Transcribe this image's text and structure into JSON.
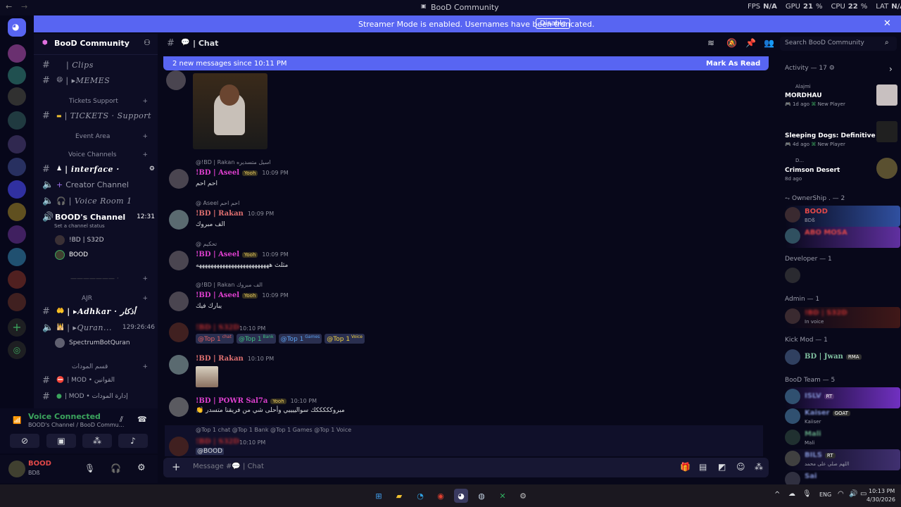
{
  "titlebar": {
    "title": "BooD Community",
    "fps_label": "FPS",
    "fps_value": "N/A",
    "gpu_label": "GPU",
    "gpu_value": "21",
    "cpu_label": "CPU",
    "cpu_value": "22",
    "lat_label": "LAT",
    "lat_value": "N/A"
  },
  "banner": {
    "text": "Streamer Mode is enabled. Usernames have been truncated.",
    "button": "Disable"
  },
  "server": {
    "name": "BooD Community"
  },
  "channels": {
    "clips": "| Clips",
    "memes": "| ▸MEMES",
    "cat_tickets": "Tickets Support",
    "tickets": "| TICKETS · Support",
    "cat_event": "Event Area",
    "cat_voice": "Voice Channels",
    "interface": "| interface ·",
    "creator": "Creator Channel",
    "voice_room": "| Voice Room 1",
    "boods_channel": "BOOD's Channel",
    "boods_time": "12:31",
    "status_hint": "Set a channel status",
    "vuser1": "!BD | S32D",
    "vuser2": "BOOD",
    "cat_ajr": "AJR",
    "adhkar": "| ▸Adhkar · أذكار",
    "quran": "| ▸Quran...",
    "quran_time": "129:26:46",
    "bot": "SpectrumBotQuran",
    "cat_mod": "قسم المودات",
    "rules": "| MOD • القوانين",
    "admin_mod": "| MOD • إدارة المودات"
  },
  "voice": {
    "title": "Voice Connected",
    "sub": "BOOD's Channel / BooD Commu..."
  },
  "user": {
    "name": "BOOD",
    "sub": "BDß"
  },
  "chat": {
    "channel": "| Chat",
    "search": "Search BooD Community",
    "new_msgs": "2 new messages since 10:11 PM",
    "mark_read": "Mark As Read",
    "composer": "Message #💬 | Chat"
  },
  "messages": [
    {
      "reply": "@!BD | Rakan اسيل متسديره",
      "name": "!BD | Aseel",
      "badge": "Yooh",
      "time": "10:09 PM",
      "text": "احم احم"
    },
    {
      "reply": "@ Aseel احم احم",
      "name": "!BD | Rakan",
      "badge": "",
      "time": "10:09 PM",
      "text": "الف مبروك"
    },
    {
      "reply": "@  تحكيم",
      "name": "!BD | Aseel",
      "badge": "Yooh",
      "time": "10:09 PM",
      "text": "مثلث هههههههههههههههههههههههههه"
    },
    {
      "reply": "@!BD | Rakan الف مبروك",
      "name": "!BD | Aseel",
      "badge": "Yooh",
      "time": "10:09 PM",
      "text": "يبارك فيك"
    },
    {
      "reply": "",
      "name": "!BD | S32D",
      "badge": "",
      "time": "10:10 PM",
      "text": ""
    },
    {
      "reply": "",
      "name": "!BD | Rakan",
      "badge": "",
      "time": "10:10 PM",
      "text": ""
    },
    {
      "reply": "",
      "name": "!BD | POWR Sal7a",
      "badge": "Yooh",
      "time": "10:10 PM",
      "text": "مبروكككككك سوالييييي وأحلى شي من فريقنا متسدر"
    },
    {
      "reply": "@Top 1 chat @Top 1 Bank @Top 1 Games @Top 1 Voice",
      "name": "!BD | S32D",
      "badge": "",
      "time": "10:10 PM",
      "text": "@BOOD"
    }
  ],
  "mentions": [
    {
      "t": "@Top 1",
      "sub": "chat",
      "c": "#e06060"
    },
    {
      "t": "@Top 1",
      "sub": "Bank",
      "c": "#40c080"
    },
    {
      "t": "@Top 1",
      "sub": "Games",
      "c": "#5aa0f0"
    },
    {
      "t": "@Top 1",
      "sub": "Voice",
      "c": "#f0d040"
    }
  ],
  "members": {
    "activity": "Activity — 17",
    "a1_user": "Alajmi",
    "a1_game": "MORDHAU",
    "a1_time": "1d ago",
    "a1_tag": "New Player",
    "a2_game": "Sleeping Dogs: Definitive E...",
    "a2_time": "4d ago",
    "a2_tag": "New Player",
    "a3_user": "D...",
    "a3_game": "Crimson Desert",
    "a3_time": "8d ago",
    "owner_hdr": "⥊ OwnerShip . — 2",
    "o1": "BOOD",
    "o1_sub": "BDß",
    "o2": "ABO MOSA",
    "dev_hdr": "Developer — 1",
    "admin_hdr": "Admin — 1",
    "admin1": "!BD | S32D",
    "admin1_sub": "In voice",
    "kick_hdr": "Kick Mod — 1",
    "kick1": "BD | Jwan",
    "kick1_tag": "RMA",
    "team_hdr": "BooD Team — 5",
    "t1": "ISLV",
    "t1_tag": "RT",
    "t2": "Kaiser",
    "t2_tag": "GOAT",
    "t2_sub": "Kaiiser",
    "t3": "Mali",
    "t3_sub": "Mali",
    "t4": "BILS",
    "t4_tag": "RT",
    "t4_sub": "اللهم صلي على محمد",
    "t5": "Sai"
  },
  "taskbar": {
    "lang": "ENG",
    "time": "10:13 PM",
    "date": "4/30/2026"
  },
  "colors": {
    "accent": "#5865f2",
    "aseel": "#e040d0",
    "rakan": "#e07070",
    "mention_bg": "#2a2f50"
  }
}
